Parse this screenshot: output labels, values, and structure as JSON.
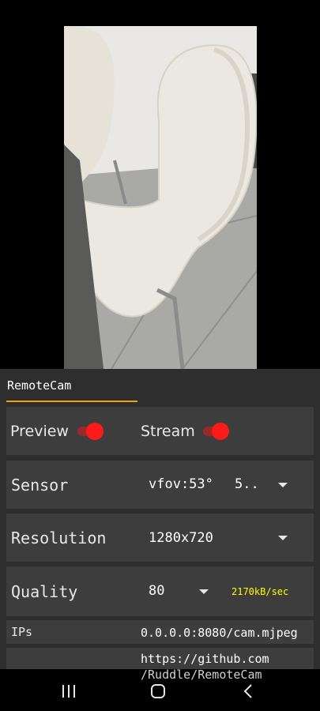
{
  "app": {
    "tab_label": "RemoteCam"
  },
  "controls": {
    "preview": {
      "label": "Preview",
      "on": true
    },
    "stream": {
      "label": "Stream",
      "on": true
    },
    "sensor": {
      "label": "Sensor",
      "value": "vfov:53°",
      "extra": "5.."
    },
    "resolution": {
      "label": "Resolution",
      "value": "1280x720"
    },
    "quality": {
      "label": "Quality",
      "value": "80",
      "rate": "2170kB/sec"
    },
    "ips": {
      "label": "IPs",
      "value": "0.0.0.0:8080/cam.mjpeg"
    },
    "link": {
      "line1": "https://github.com",
      "line2": "/Ruddle/RemoteCam"
    }
  },
  "colors": {
    "accent": "#f2a300",
    "toggle": "#ff1a1a",
    "rate": "#ffff00"
  },
  "navbar": {
    "icons": [
      "recent-apps-icon",
      "home-icon",
      "back-icon"
    ]
  }
}
